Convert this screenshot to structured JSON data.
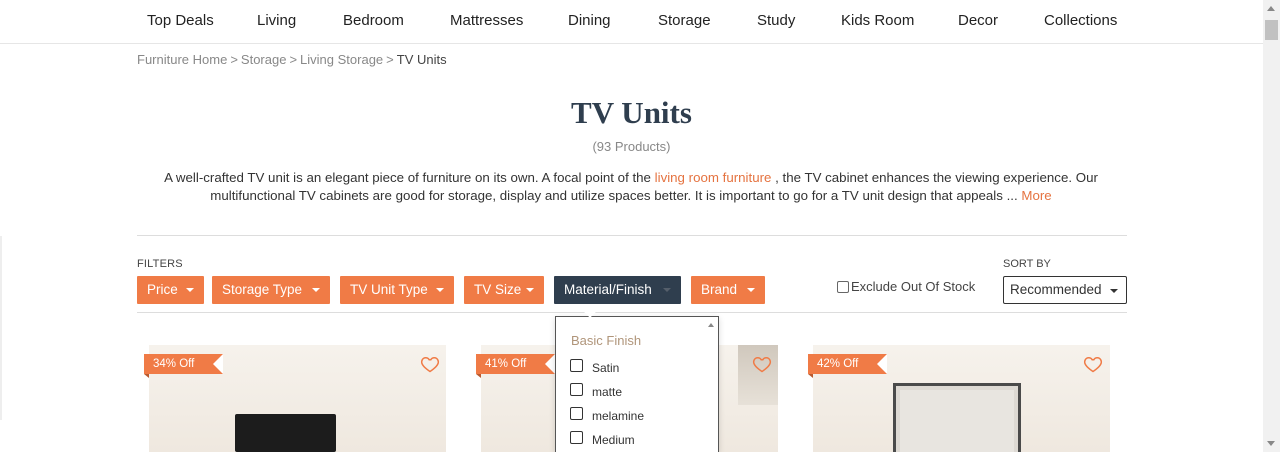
{
  "nav": {
    "items": [
      "Top Deals",
      "Living",
      "Bedroom",
      "Mattresses",
      "Dining",
      "Storage",
      "Study",
      "Kids Room",
      "Decor",
      "Collections"
    ]
  },
  "breadcrumb": {
    "items": [
      "Furniture Home",
      "Storage",
      "Living Storage"
    ],
    "separator": ">",
    "current": "TV Units"
  },
  "page": {
    "title": "TV Units",
    "count": "(93 Products)"
  },
  "description": {
    "part1": "A well-crafted TV unit is an elegant piece of furniture on its own. A focal point of the",
    "link": "living room furniture",
    "part2": ", the TV cabinet enhances the viewing experience. Our multifunctional TV cabinets are good for storage, display and utilize spaces better. It is important to go for a TV unit design that appeals ...",
    "more": "More"
  },
  "filters": {
    "label": "FILTERS",
    "buttons": [
      "Price",
      "Storage Type",
      "TV Unit Type",
      "TV Size",
      "Material/Finish",
      "Brand"
    ],
    "active": "Material/Finish",
    "exclude_label": "Exclude Out Of Stock"
  },
  "sort": {
    "label": "SORT BY",
    "selected": "Recommended"
  },
  "dropdown": {
    "heading": "Basic Finish",
    "options": [
      "Satin",
      "matte",
      "melamine",
      "Medium"
    ]
  },
  "products": [
    {
      "badge": "34% Off"
    },
    {
      "badge": "41% Off"
    },
    {
      "badge": "42% Off"
    }
  ],
  "colors": {
    "accent": "#f07b46",
    "active_filter": "#2f3e4e",
    "link": "#e57340"
  },
  "icons": {
    "heart": "heart-icon",
    "caret": "caret-down-icon",
    "scroll_up": "scroll-up-arrow-icon",
    "scroll_down": "scroll-down-arrow-icon"
  }
}
